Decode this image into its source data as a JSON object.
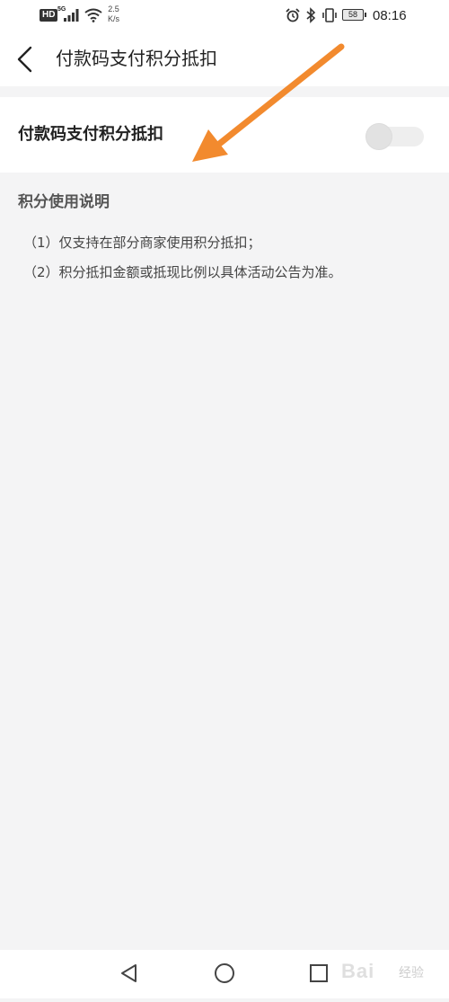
{
  "status_bar": {
    "hd": "HD",
    "network": "5G",
    "speed_value": "2.5",
    "speed_unit": "K/s",
    "battery": "58",
    "time": "08:16"
  },
  "header": {
    "title": "付款码支付积分抵扣"
  },
  "setting": {
    "label": "付款码支付积分抵扣",
    "enabled": false
  },
  "description": {
    "title": "积分使用说明",
    "lines": [
      "（1）仅支持在部分商家使用积分抵扣；",
      "（2）积分抵扣金额或抵现比例以具体活动公告为准。"
    ]
  },
  "annotation": {
    "arrow_color": "#f28a2e"
  },
  "watermark": {
    "brand": "Bai",
    "suffix": "经验"
  },
  "colors": {
    "background": "#f4f4f5",
    "surface": "#ffffff",
    "text_primary": "#222222",
    "text_secondary": "#555555"
  }
}
